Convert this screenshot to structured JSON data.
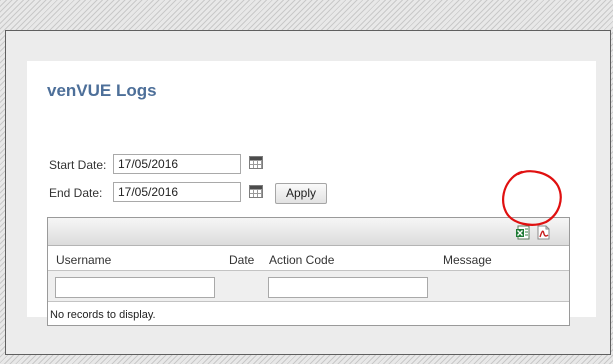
{
  "page": {
    "title": "venVUE Logs"
  },
  "filters": {
    "start_label": "Start Date:",
    "start_value": "17/05/2016",
    "end_label": "End Date:",
    "end_value": "17/05/2016",
    "apply_label": "Apply",
    "calendar_icon": "calendar-icon"
  },
  "grid": {
    "toolbar": {
      "export_excel_icon": "excel-export-icon",
      "export_pdf_icon": "pdf-export-icon"
    },
    "columns": [
      "Username",
      "Date",
      "Action Code",
      "Message"
    ],
    "empty_message": "No records to display."
  },
  "colors": {
    "title": "#4d6f99",
    "annotation": "#e01010"
  }
}
